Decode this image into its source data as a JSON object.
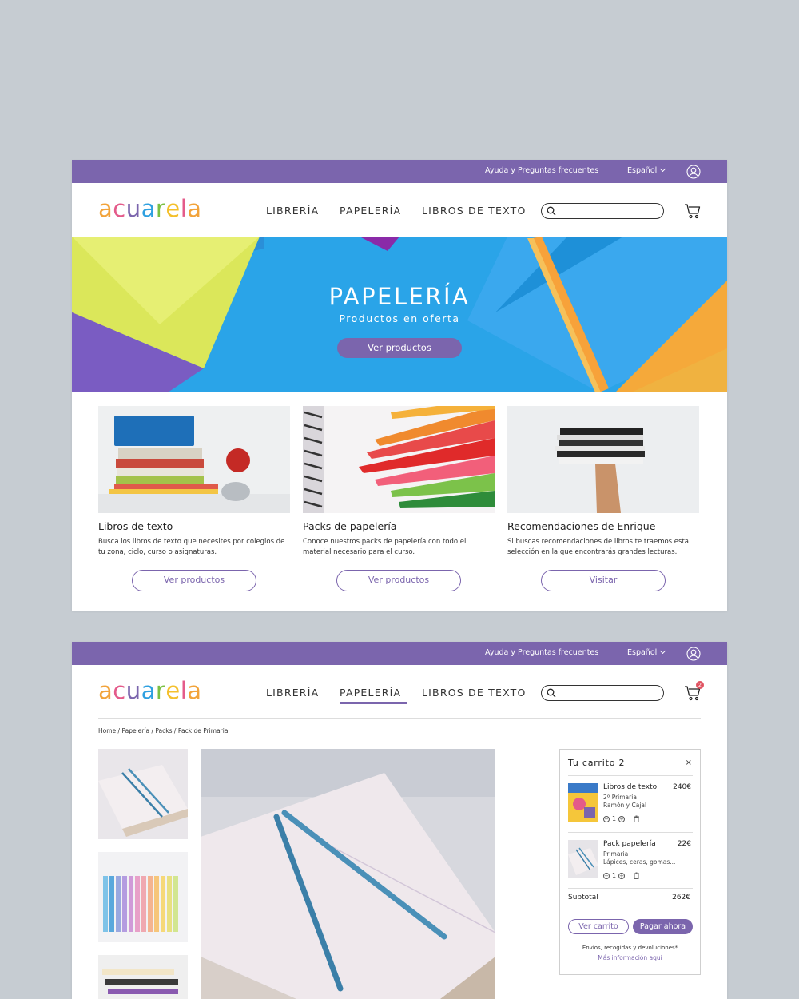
{
  "topbar": {
    "help": "Ayuda y Preguntas frecuentes",
    "language": "Español"
  },
  "logo": {
    "letters": [
      "a",
      "c",
      "u",
      "a",
      "r",
      "e",
      "l",
      "a"
    ],
    "colors": [
      "#f2a33a",
      "#e45b8a",
      "#7b65ad",
      "#2ea0e0",
      "#7bc043",
      "#f4c02c",
      "#e45b8a",
      "#f2a33a"
    ]
  },
  "nav": {
    "items": [
      "LIBRERÍA",
      "PAPELERÍA",
      "LIBROS DE TEXTO"
    ],
    "active_index_page2": 1
  },
  "cart_badge": "2",
  "hero": {
    "title": "PAPELERÍA",
    "subtitle": "Productos en oferta",
    "button": "Ver productos"
  },
  "cards": [
    {
      "title": "Libros de texto",
      "description": "Busca los libros de texto que necesites por colegios de tu zona, ciclo, curso o asignaturas.",
      "button": "Ver productos"
    },
    {
      "title": "Packs de papelería",
      "description": "Conoce nuestros packs de papelería con todo el material necesario para el curso.",
      "button": "Ver productos"
    },
    {
      "title": "Recomendaciones de Enrique",
      "description": "Si buscas recomendaciones de libros te traemos esta selección en la que encontrarás grandes lecturas.",
      "button": "Visitar"
    }
  ],
  "breadcrumb": {
    "path": "Home / Papelería / Packs / ",
    "current": "Pack de Primaria"
  },
  "cart": {
    "title": "Tu carrito 2",
    "close": "×",
    "items": [
      {
        "name": "Libros de texto",
        "price": "240€",
        "line1": "2º Primaria",
        "line2": "Ramón y Cajal",
        "qty": "1"
      },
      {
        "name": "Pack papelería",
        "price": "22€",
        "line1": "Primaria",
        "line2": "Lápices, ceras, gomas...",
        "qty": "1"
      }
    ],
    "subtotal_label": "Subtotal",
    "subtotal_value": "262€",
    "view_cart": "Ver carrito",
    "pay_now": "Pagar ahora",
    "shipping_note": "Envíos, recogidas y devoluciones*",
    "more_info": "Más información aquí"
  },
  "colors": {
    "brand_purple": "#7b65ad",
    "hero_blue": "#2aa4e8",
    "badge_red": "#e05260"
  }
}
